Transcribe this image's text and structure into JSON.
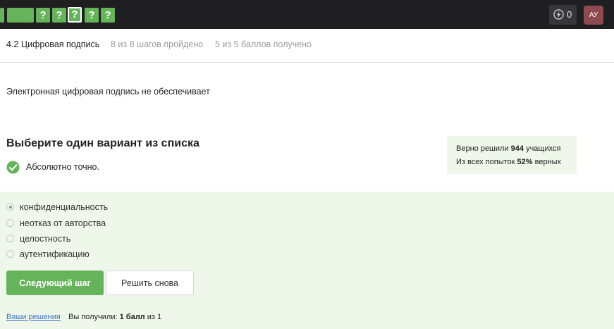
{
  "topbar": {
    "steps": [
      {
        "label": "",
        "state": "done"
      },
      {
        "label": "",
        "state": "done"
      },
      {
        "label": "",
        "state": "done"
      },
      {
        "label": "?",
        "state": "done"
      },
      {
        "label": "?",
        "state": "done"
      },
      {
        "label": "?",
        "state": "current"
      },
      {
        "label": "?",
        "state": "done"
      },
      {
        "label": "?",
        "state": "done"
      }
    ],
    "energy_count": "0",
    "avatar_initials": "АУ"
  },
  "lesson": {
    "title": "4.2 Цифровая подпись",
    "steps_progress": "8 из 8 шагов пройдено",
    "score": "5 из 5 баллов  получено"
  },
  "question": {
    "text": "Электронная цифровая подпись не обеспечивает",
    "select_title": "Выберите один вариант из списка",
    "feedback": "Абсолютно точно."
  },
  "stats": {
    "line1_prefix": "Верно решили",
    "line1_count": "944",
    "line1_suffix": "учащихся",
    "line2_prefix": "Из всех попыток",
    "line2_percent": "52%",
    "line2_suffix": "верных"
  },
  "options": [
    {
      "label": "конфиденциальность",
      "checked": true
    },
    {
      "label": "неотказ от авторства",
      "checked": false
    },
    {
      "label": "целостность",
      "checked": false
    },
    {
      "label": "аутентификацию",
      "checked": false
    }
  ],
  "actions": {
    "next_label": "Следующий шаг",
    "retry_label": "Решить снова"
  },
  "footer": {
    "solutions_link": "Ваши решения",
    "result_prefix": "Вы получили:",
    "result_value": "1 балл",
    "result_suffix": "из 1"
  },
  "colors": {
    "accent_green": "#66b45a",
    "answer_bg": "#eef7ea",
    "topbar_bg": "#1f1f22",
    "link": "#3b71c7"
  },
  "icons": {
    "energy": "lightning-icon",
    "feedback": "checkmark-icon"
  }
}
